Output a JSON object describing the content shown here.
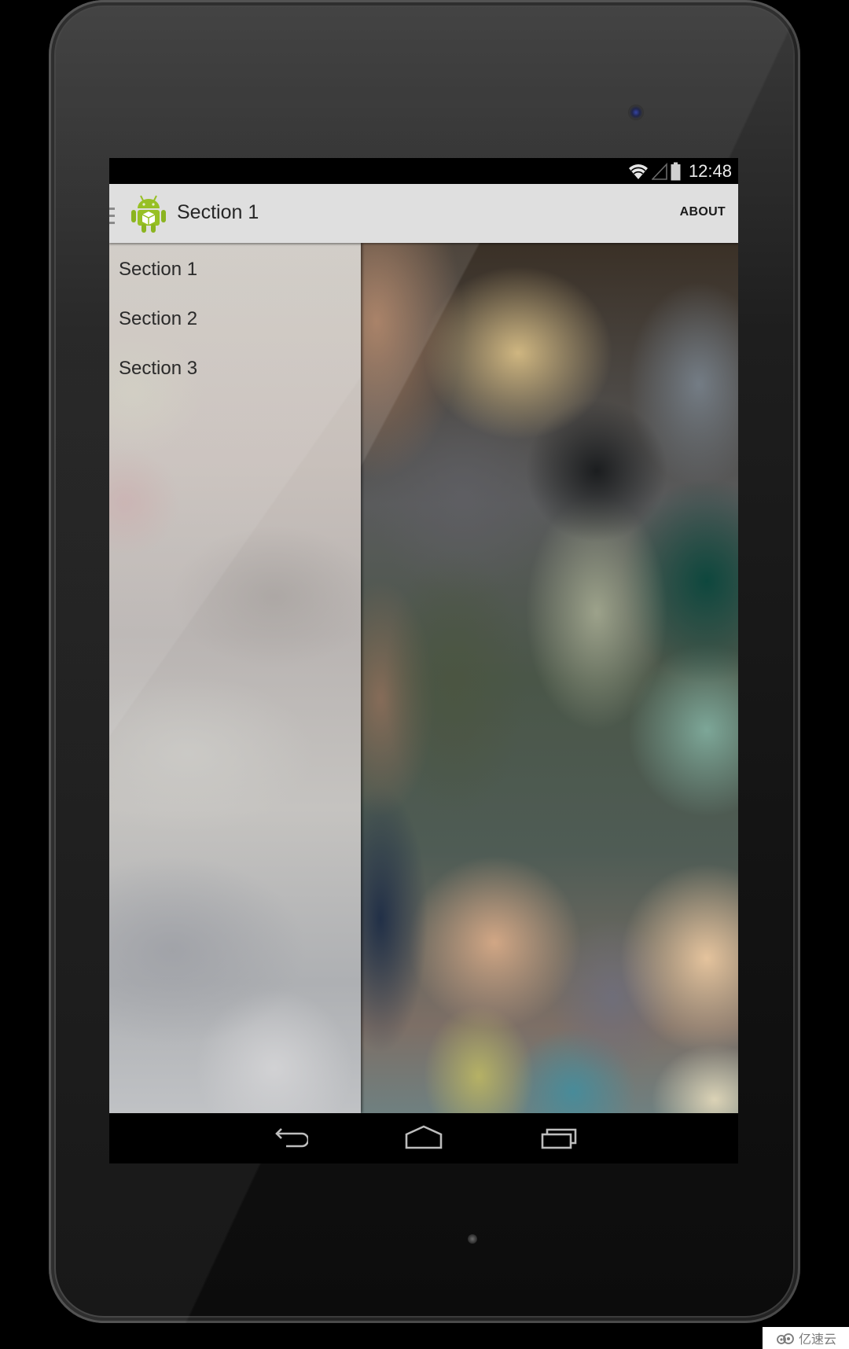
{
  "status_bar": {
    "time": "12:48",
    "icons": [
      "wifi-icon",
      "cell-signal-icon",
      "battery-icon"
    ]
  },
  "action_bar": {
    "title": "Section 1",
    "app_icon": "android-app-icon",
    "drawer_indicator": "drawer-indicator-icon",
    "about_label": "ABOUT"
  },
  "drawer": {
    "items": [
      {
        "label": "Section 1"
      },
      {
        "label": "Section 2"
      },
      {
        "label": "Section 3"
      }
    ]
  },
  "nav_bar": {
    "buttons": [
      "back-icon",
      "home-icon",
      "recents-icon"
    ]
  },
  "watermark": {
    "text": "亿速云"
  },
  "colors": {
    "action_bar_bg": "#dfdfdf",
    "android_green": "#97c024",
    "nav_icon": "#bdbdbd"
  }
}
